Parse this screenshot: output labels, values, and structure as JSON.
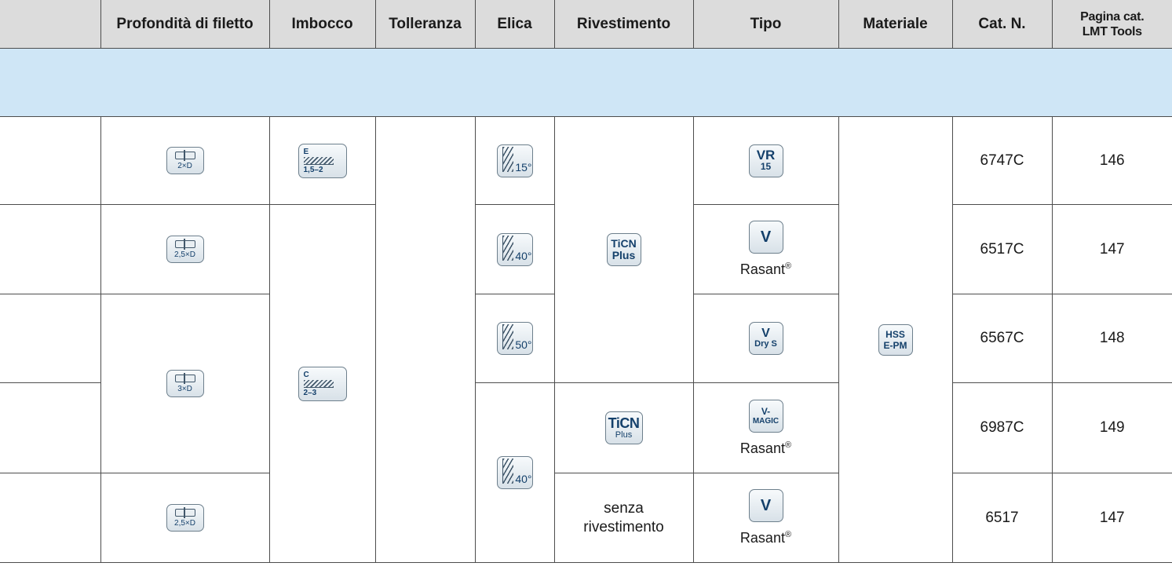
{
  "headers": {
    "c0": "",
    "depth": "Profondità di filetto",
    "imbocco": "Imbocco",
    "tolleranza": "Tolleranza",
    "elica": "Elica",
    "rivestimento": "Rivestimento",
    "tipo": "Tipo",
    "materiale": "Materiale",
    "catn": "Cat. N.",
    "pagina_line1": "Pagina cat.",
    "pagina_line2": "LMT Tools"
  },
  "depth_icons": {
    "r1": "2×D",
    "r2": "2,5×D",
    "r34": "3×D",
    "r5": "2,5×D"
  },
  "imbocco_icons": {
    "e": {
      "letter": "E",
      "range": "1,5–2"
    },
    "c": {
      "letter": "C",
      "range": "2–3"
    }
  },
  "elica_icons": {
    "r1": "15°",
    "r2": "40°",
    "r3": "50°",
    "r45": "40°"
  },
  "rivestimento": {
    "ticn_plus": {
      "line1": "TiCN",
      "line2": "Plus"
    },
    "ticn_plus2": {
      "line1": "TiCN",
      "line2": "Plus"
    },
    "none_line1": "senza",
    "none_line2": "rivestimento"
  },
  "tipo": {
    "r1": {
      "line1": "VR",
      "line2": "15"
    },
    "r2": {
      "label": "V",
      "name": "Rasant",
      "mark": "®"
    },
    "r3": {
      "line1": "V",
      "line2": "Dry S"
    },
    "r4": {
      "line1": "V-",
      "line2": "MAGIC",
      "name": "Rasant",
      "mark": "®"
    },
    "r5": {
      "label": "V",
      "name": "Rasant",
      "mark": "®"
    }
  },
  "materiale": {
    "line1": "HSS",
    "line2": "E-PM"
  },
  "rows": [
    {
      "cat": "6747C",
      "page": "146"
    },
    {
      "cat": "6517C",
      "page": "147"
    },
    {
      "cat": "6567C",
      "page": "148"
    },
    {
      "cat": "6987C",
      "page": "149"
    },
    {
      "cat": "6517",
      "page": "147"
    }
  ]
}
